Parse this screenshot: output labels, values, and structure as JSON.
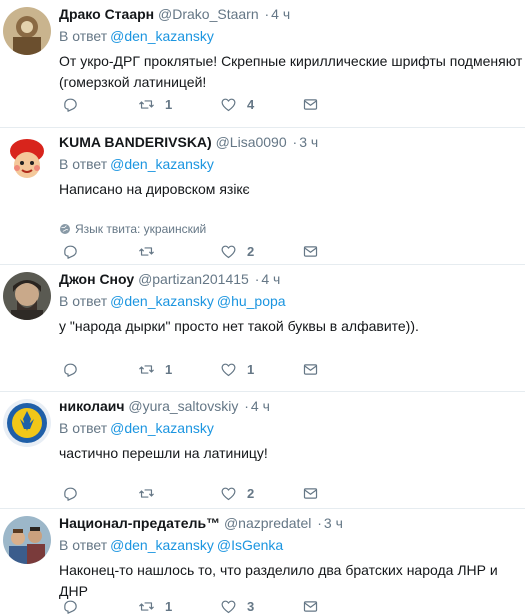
{
  "reply_prefix": "В ответ",
  "language_note": "Язык твита: украинский",
  "replies": [
    {
      "name": "Драко Стаарн",
      "handle": "@Drako_Staarn",
      "time": "4 ч",
      "mentions": [
        "@den_kazansky"
      ],
      "text": "От укро-ДРГ проклятые! Скрепные кириллические шрифты подменяют (гомерзкой латиницей!",
      "replies": "",
      "retweets": "1",
      "likes": "4"
    },
    {
      "name": "KUMA BANDERIVSKA)",
      "handle": "@Lisa0090",
      "time": "3 ч",
      "mentions": [
        "@den_kazansky"
      ],
      "text": "Написано на дировском язікє",
      "replies": "",
      "retweets": "",
      "likes": "2"
    },
    {
      "name": "Джон Сноу",
      "handle": "@partizan201415",
      "time": "4 ч",
      "mentions": [
        "@den_kazansky",
        "@hu_popa"
      ],
      "text": "у \"народа дырки\" просто нет такой буквы в алфавите)).",
      "replies": "",
      "retweets": "1",
      "likes": "1"
    },
    {
      "name": "николаич",
      "handle": "@yura_saltovskiy",
      "time": "4 ч",
      "mentions": [
        "@den_kazansky"
      ],
      "text": "частично перешли на латиницу!",
      "replies": "",
      "retweets": "",
      "likes": "2"
    },
    {
      "name": "Национал-предатель™",
      "handle": "@nazpredatel",
      "time": "3 ч",
      "mentions": [
        "@den_kazansky",
        "@IsGenka"
      ],
      "text": "Наконец-то нашлось то, что разделило два братских народа ЛНР и ДНР",
      "replies": "",
      "retweets": "1",
      "likes": "3"
    }
  ]
}
